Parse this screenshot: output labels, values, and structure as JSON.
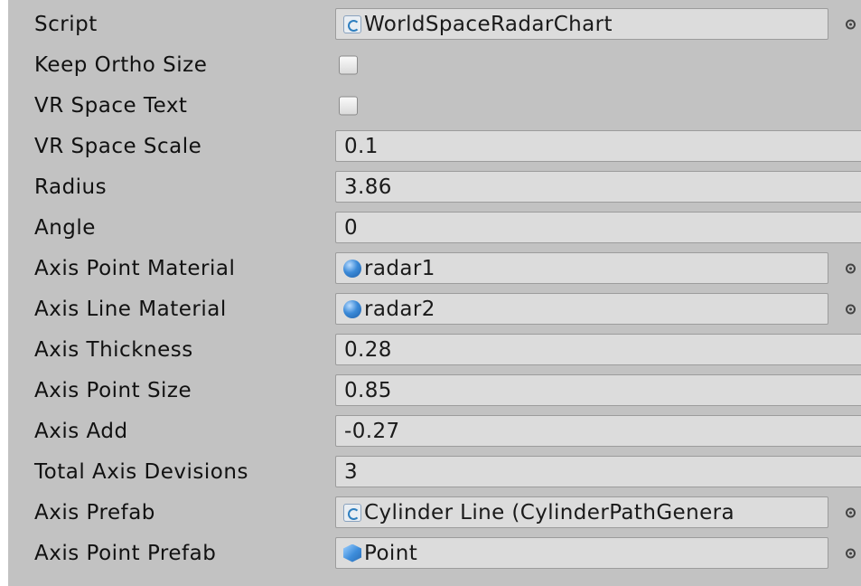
{
  "inspector": {
    "rows": [
      {
        "label": "Script",
        "type": "object",
        "value": "WorldSpaceRadarChart",
        "icon": "script-icon"
      },
      {
        "label": "Keep Ortho Size",
        "type": "checkbox",
        "checked": false
      },
      {
        "label": "VR Space Text",
        "type": "checkbox",
        "checked": false
      },
      {
        "label": "VR Space Scale",
        "type": "number",
        "value": "0.1"
      },
      {
        "label": "Radius",
        "type": "number",
        "value": "3.86"
      },
      {
        "label": "Angle",
        "type": "number",
        "value": "0"
      },
      {
        "label": "Axis Point Material",
        "type": "object",
        "value": "radar1",
        "icon": "material-icon"
      },
      {
        "label": "Axis Line Material",
        "type": "object",
        "value": "radar2",
        "icon": "material-icon"
      },
      {
        "label": "Axis Thickness",
        "type": "number",
        "value": "0.28"
      },
      {
        "label": "Axis Point Size",
        "type": "number",
        "value": "0.85"
      },
      {
        "label": "Axis Add",
        "type": "number",
        "value": "-0.27"
      },
      {
        "label": "Total Axis Devisions",
        "type": "number",
        "value": "3"
      },
      {
        "label": "Axis Prefab",
        "type": "object",
        "value": "Cylinder Line (CylinderPathGenera",
        "icon": "script-icon"
      },
      {
        "label": "Axis Point Prefab",
        "type": "object",
        "value": "Point",
        "icon": "prefab-icon"
      }
    ]
  },
  "colors": {
    "panel_background": "#c2c2c2",
    "field_background": "#dcdcdc",
    "field_border": "#9c9c9c",
    "text": "#111111"
  }
}
